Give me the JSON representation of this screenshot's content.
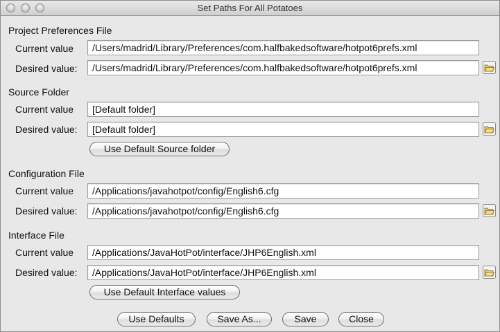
{
  "window": {
    "title": "Set Paths For All Potatoes"
  },
  "sections": [
    {
      "title": "Project Preferences File",
      "current_label": "Current value",
      "current_value": "/Users/madrid/Library/Preferences/com.halfbakedsoftware/hotpot6prefs.xml",
      "desired_label": "Desired value:",
      "desired_value": "/Users/madrid/Library/Preferences/com.halfbakedsoftware/hotpot6prefs.xml"
    },
    {
      "title": "Source Folder",
      "current_label": "Current value",
      "current_value": "[Default folder]",
      "desired_label": "Desired value:",
      "desired_value": "[Default folder]",
      "default_button": "Use Default Source folder"
    },
    {
      "title": "Configuration File",
      "current_label": "Current value",
      "current_value": "/Applications/javahotpot/config/English6.cfg",
      "desired_label": "Desired value:",
      "desired_value": "/Applications/javahotpot/config/English6.cfg"
    },
    {
      "title": "Interface File",
      "current_label": "Current value",
      "current_value": "/Applications/JavaHotPot/interface/JHP6English.xml",
      "desired_label": "Desired value:",
      "desired_value": "/Applications/JavaHotPot/interface/JHP6English.xml",
      "default_button": "Use Default Interface values"
    }
  ],
  "footer": {
    "use_defaults": "Use Defaults",
    "save_as": "Save As...",
    "save": "Save",
    "close": "Close"
  },
  "icons": {
    "browse": "folder-open-icon"
  },
  "colors": {
    "window_bg": "#e8e8e8",
    "field_bg": "#ffffff",
    "folder_icon": "#d8b44a"
  }
}
